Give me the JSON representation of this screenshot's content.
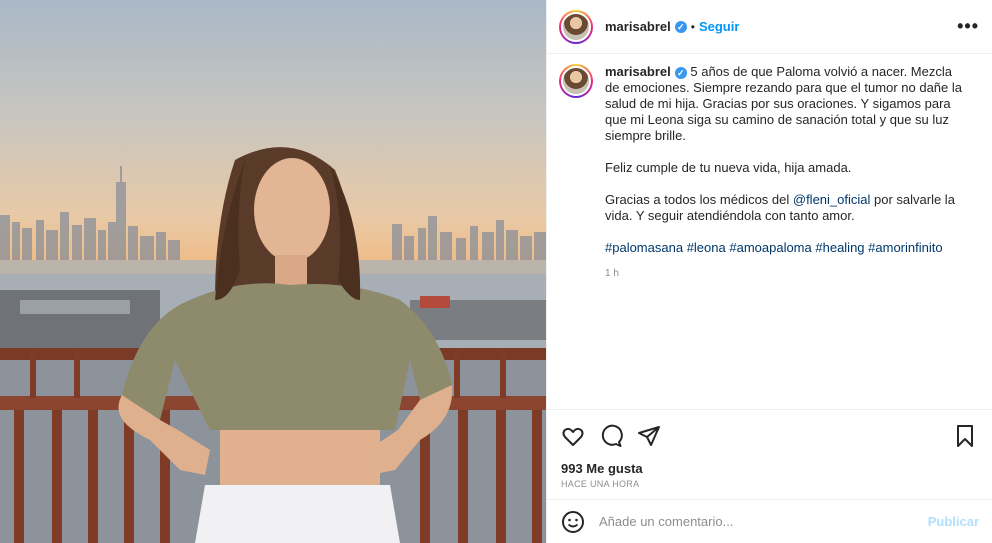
{
  "post": {
    "username": "marisabrel",
    "verified_mark": "✓",
    "separator": "•",
    "follow_label": "Seguir",
    "more_label": "•••"
  },
  "caption": {
    "username": "marisabrel",
    "text1": " 5 años de que Paloma volvió a nacer. Mezcla de emociones. Siempre rezando para que el tumor no dañe la salud de mi hija. Gracias por sus oraciones. Y sigamos para que mi Leona siga su camino de sanación total y que su luz siempre brille.",
    "text2": "Feliz cumple de tu nueva vida, hija amada.",
    "text3_before": "Gracias a todos los médicos del ",
    "mention": "@fleni_oficial",
    "text3_after": " por salvarle la vida. Y seguir atendiéndola con tanto amor.",
    "hashtags": [
      "#palomasana",
      "#leona",
      "#amoapaloma",
      "#healing",
      "#amorinfinito"
    ],
    "time": "1 h"
  },
  "actions": {
    "like_icon": "heart-icon",
    "comment_icon": "comment-icon",
    "share_icon": "share-icon",
    "save_icon": "bookmark-icon",
    "likes": "993 Me gusta",
    "ago": "HACE UNA HORA"
  },
  "comment_box": {
    "placeholder": "Añade un comentario...",
    "publish_label": "Publicar",
    "emoji_icon": "smiley-icon"
  },
  "colors": {
    "link": "#0095f6",
    "hashtag": "#00376b",
    "muted": "#8e8e8e",
    "publish_disabled": "#b2dffc"
  }
}
